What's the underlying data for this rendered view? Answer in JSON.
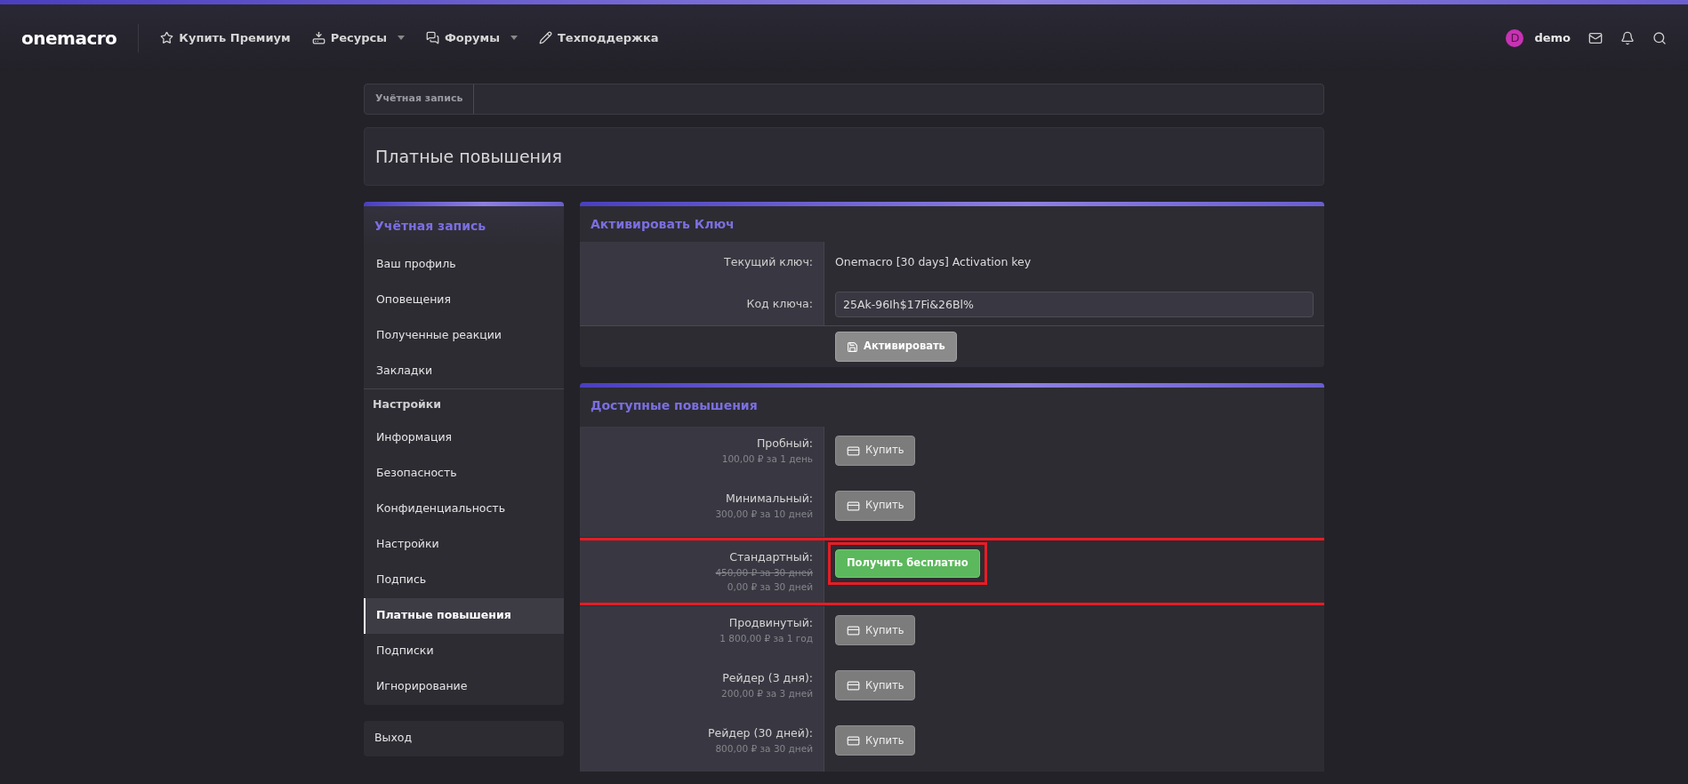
{
  "header": {
    "logo": "onemacro",
    "nav": [
      {
        "label": "Купить Премиум",
        "has_menu": false
      },
      {
        "label": "Ресурсы",
        "has_menu": true
      },
      {
        "label": "Форумы",
        "has_menu": true
      },
      {
        "label": "Техподдержка",
        "has_menu": false
      }
    ],
    "user": {
      "initial": "D",
      "name": "demo",
      "color": "#c832b4"
    }
  },
  "breadcrumb": [
    "Учётная запись"
  ],
  "page_title": "Платные повышения",
  "sidebar": {
    "sections": [
      {
        "title": "Учётная запись",
        "kind": "heading",
        "items": [
          {
            "label": "Ваш профиль",
            "selected": false
          },
          {
            "label": "Оповещения",
            "selected": false
          },
          {
            "label": "Полученные реакции",
            "selected": false
          },
          {
            "label": "Закладки",
            "selected": false
          }
        ]
      },
      {
        "title": "Настройки",
        "kind": "subheading",
        "items": [
          {
            "label": "Информация",
            "selected": false
          },
          {
            "label": "Безопасность",
            "selected": false
          },
          {
            "label": "Конфиденциальность",
            "selected": false
          },
          {
            "label": "Настройки",
            "selected": false
          },
          {
            "label": "Подпись",
            "selected": false
          },
          {
            "label": "Платные повышения",
            "selected": true
          },
          {
            "label": "Подписки",
            "selected": false
          },
          {
            "label": "Игнорирование",
            "selected": false
          }
        ]
      }
    ],
    "logout": "Выход"
  },
  "activate": {
    "title": "Активировать Ключ",
    "rows": [
      {
        "kind": "text",
        "label": "Текущий ключ:",
        "value": "Onemacro [30 days] Activation key"
      },
      {
        "kind": "input",
        "label": "Код ключа:",
        "value": "25Ak-96Ih$17Fi&26Bl%"
      }
    ],
    "button": "Активировать"
  },
  "upgrades": {
    "title": "Доступные повышения",
    "rows": [
      {
        "name": "Пробный:",
        "prices": [
          {
            "text": "100,00 ₽ за 1 день",
            "struck": false
          }
        ],
        "button": {
          "kind": "buy",
          "label": "Купить"
        },
        "highlighted": false
      },
      {
        "name": "Минимальный:",
        "prices": [
          {
            "text": "300,00 ₽ за 10 дней",
            "struck": false
          }
        ],
        "button": {
          "kind": "buy",
          "label": "Купить"
        },
        "highlighted": false
      },
      {
        "name": "Стандартный:",
        "prices": [
          {
            "text": "450,00 ₽ за 30 дней",
            "struck": true
          },
          {
            "text": "0,00 ₽ за 30 дней",
            "struck": false
          }
        ],
        "button": {
          "kind": "free",
          "label": "Получить бесплатно"
        },
        "highlighted": true
      },
      {
        "name": "Продвинутый:",
        "prices": [
          {
            "text": "1 800,00 ₽ за 1 год",
            "struck": false
          }
        ],
        "button": {
          "kind": "buy",
          "label": "Купить"
        },
        "highlighted": false
      },
      {
        "name": "Рейдер (3 дня):",
        "prices": [
          {
            "text": "200,00 ₽ за 3 дней",
            "struck": false
          }
        ],
        "button": {
          "kind": "buy",
          "label": "Купить"
        },
        "highlighted": false
      },
      {
        "name": "Рейдер (30 дней):",
        "prices": [
          {
            "text": "800,00 ₽ за 30 дней",
            "struck": false
          }
        ],
        "button": {
          "kind": "buy",
          "label": "Купить"
        },
        "highlighted": false
      }
    ]
  }
}
